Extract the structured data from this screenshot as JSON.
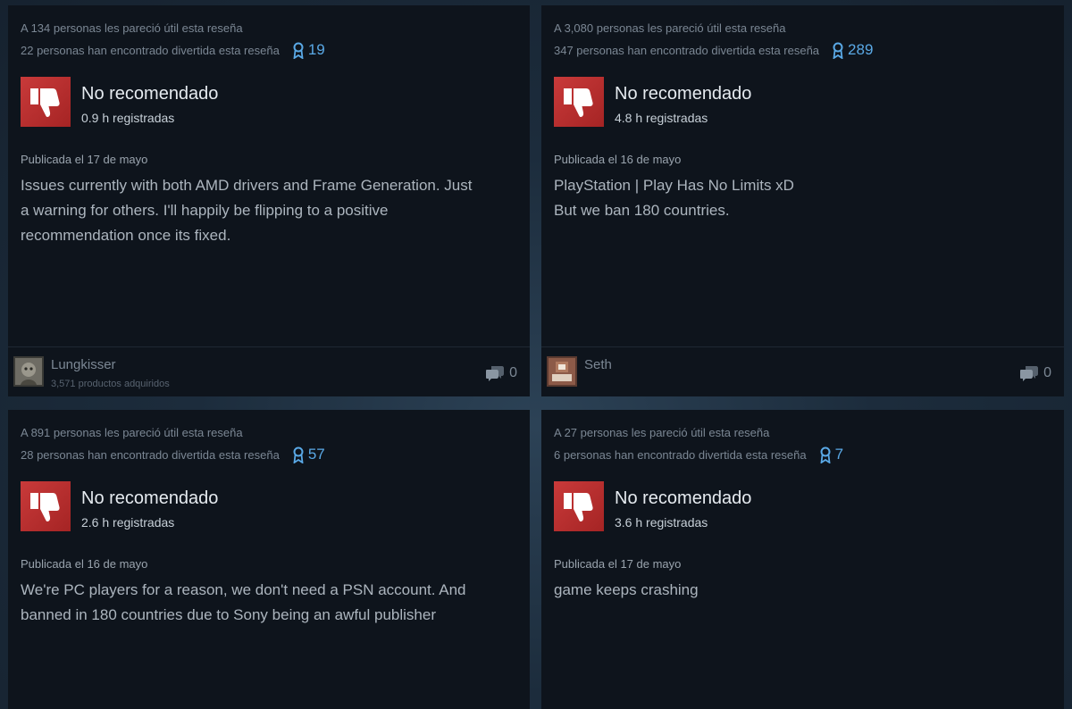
{
  "reviews": [
    {
      "helpful": "A 134 personas les pareció útil esta reseña",
      "funny": "22 personas han encontrado divertida esta reseña",
      "awards": "19",
      "recommendation": "No recomendado",
      "hours": "0.9 h registradas",
      "posted": "Publicada el 17 de mayo",
      "body": [
        "Issues currently with both AMD drivers and Frame Generation. Just",
        "a warning for others. I'll happily be flipping to a positive",
        "recommendation once its fixed."
      ],
      "author": "Lungkisser",
      "products": "3,571 productos adquiridos",
      "comments": "0"
    },
    {
      "helpful": "A 3,080 personas les pareció útil esta reseña",
      "funny": "347 personas han encontrado divertida esta reseña",
      "awards": "289",
      "recommendation": "No recomendado",
      "hours": "4.8 h registradas",
      "posted": "Publicada el 16 de mayo",
      "body": [
        "PlayStation | Play Has No Limits xD",
        "But we ban 180 countries."
      ],
      "author": "Seth",
      "comments": "0"
    },
    {
      "helpful": "A 891 personas les pareció útil esta reseña",
      "funny": "28 personas han encontrado divertida esta reseña",
      "awards": "57",
      "recommendation": "No recomendado",
      "hours": "2.6 h registradas",
      "posted": "Publicada el 16 de mayo",
      "body": [
        "We're PC players for a reason, we don't need a PSN account. And",
        "banned in 180 countries due to Sony being an awful publisher"
      ]
    },
    {
      "helpful": "A 27 personas les pareció útil esta reseña",
      "funny": "6 personas han encontrado divertida esta reseña",
      "awards": "7",
      "recommendation": "No recomendado",
      "hours": "3.6 h registradas",
      "posted": "Publicada el 17 de mayo",
      "body": [
        "game keeps crashing"
      ]
    }
  ],
  "icons": {
    "thumb": "thumbs-down-icon",
    "award": "award-ribbon-icon",
    "comment": "comment-bubble-icon"
  },
  "colors": {
    "card_bg": "#0e141c",
    "thumb_red": "#c93a3a",
    "award_blue": "#5aa9e6"
  }
}
